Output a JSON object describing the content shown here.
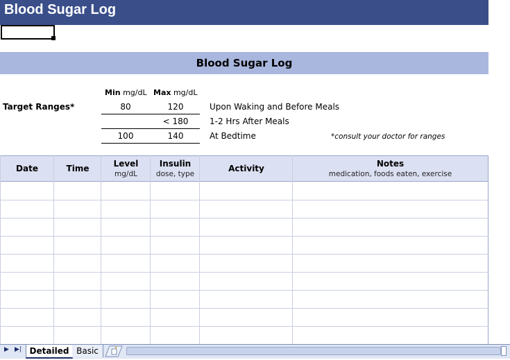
{
  "header": {
    "title": "Blood Sugar Log"
  },
  "banner": {
    "title": "Blood Sugar Log"
  },
  "targets": {
    "label": "Target Ranges*",
    "min_bold": "Min",
    "min_unit": "mg/dL",
    "max_bold": "Max",
    "max_unit": "mg/dL",
    "rows": [
      {
        "min": "80",
        "max": "120",
        "desc": "Upon Waking and Before Meals"
      },
      {
        "min": "",
        "max": "< 180",
        "desc": "1-2 Hrs After Meals"
      },
      {
        "min": "100",
        "max": "140",
        "desc": "At Bedtime"
      }
    ],
    "note": "*consult your doctor for ranges"
  },
  "table": {
    "columns": [
      {
        "title": "Date",
        "sub": ""
      },
      {
        "title": "Time",
        "sub": ""
      },
      {
        "title": "Level",
        "sub": "mg/dL"
      },
      {
        "title": "Insulin",
        "sub": "dose, type"
      },
      {
        "title": "Activity",
        "sub": ""
      },
      {
        "title": "Notes",
        "sub": "medication, foods eaten, exercise"
      }
    ]
  },
  "tabs": {
    "nav_first": "▶",
    "nav_next": "▶|",
    "items": [
      {
        "label": "Detailed",
        "active": true
      },
      {
        "label": "Basic",
        "active": false
      }
    ]
  }
}
